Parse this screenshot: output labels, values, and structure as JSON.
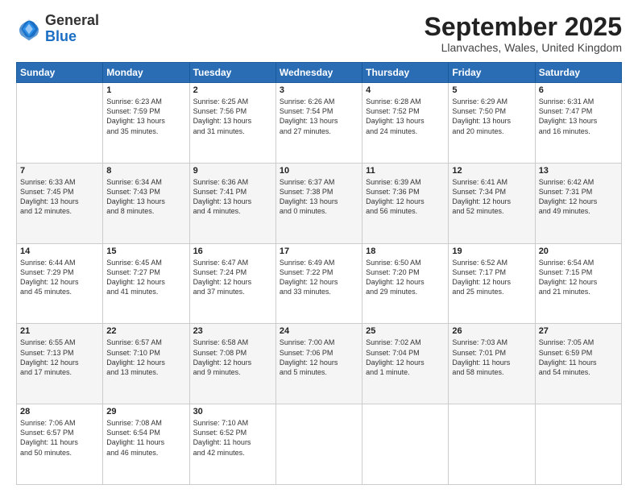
{
  "header": {
    "logo_general": "General",
    "logo_blue": "Blue",
    "month": "September 2025",
    "location": "Llanvaches, Wales, United Kingdom"
  },
  "days_of_week": [
    "Sunday",
    "Monday",
    "Tuesday",
    "Wednesday",
    "Thursday",
    "Friday",
    "Saturday"
  ],
  "weeks": [
    [
      {
        "day": "",
        "info": ""
      },
      {
        "day": "1",
        "info": "Sunrise: 6:23 AM\nSunset: 7:59 PM\nDaylight: 13 hours\nand 35 minutes."
      },
      {
        "day": "2",
        "info": "Sunrise: 6:25 AM\nSunset: 7:56 PM\nDaylight: 13 hours\nand 31 minutes."
      },
      {
        "day": "3",
        "info": "Sunrise: 6:26 AM\nSunset: 7:54 PM\nDaylight: 13 hours\nand 27 minutes."
      },
      {
        "day": "4",
        "info": "Sunrise: 6:28 AM\nSunset: 7:52 PM\nDaylight: 13 hours\nand 24 minutes."
      },
      {
        "day": "5",
        "info": "Sunrise: 6:29 AM\nSunset: 7:50 PM\nDaylight: 13 hours\nand 20 minutes."
      },
      {
        "day": "6",
        "info": "Sunrise: 6:31 AM\nSunset: 7:47 PM\nDaylight: 13 hours\nand 16 minutes."
      }
    ],
    [
      {
        "day": "7",
        "info": "Sunrise: 6:33 AM\nSunset: 7:45 PM\nDaylight: 13 hours\nand 12 minutes."
      },
      {
        "day": "8",
        "info": "Sunrise: 6:34 AM\nSunset: 7:43 PM\nDaylight: 13 hours\nand 8 minutes."
      },
      {
        "day": "9",
        "info": "Sunrise: 6:36 AM\nSunset: 7:41 PM\nDaylight: 13 hours\nand 4 minutes."
      },
      {
        "day": "10",
        "info": "Sunrise: 6:37 AM\nSunset: 7:38 PM\nDaylight: 13 hours\nand 0 minutes."
      },
      {
        "day": "11",
        "info": "Sunrise: 6:39 AM\nSunset: 7:36 PM\nDaylight: 12 hours\nand 56 minutes."
      },
      {
        "day": "12",
        "info": "Sunrise: 6:41 AM\nSunset: 7:34 PM\nDaylight: 12 hours\nand 52 minutes."
      },
      {
        "day": "13",
        "info": "Sunrise: 6:42 AM\nSunset: 7:31 PM\nDaylight: 12 hours\nand 49 minutes."
      }
    ],
    [
      {
        "day": "14",
        "info": "Sunrise: 6:44 AM\nSunset: 7:29 PM\nDaylight: 12 hours\nand 45 minutes."
      },
      {
        "day": "15",
        "info": "Sunrise: 6:45 AM\nSunset: 7:27 PM\nDaylight: 12 hours\nand 41 minutes."
      },
      {
        "day": "16",
        "info": "Sunrise: 6:47 AM\nSunset: 7:24 PM\nDaylight: 12 hours\nand 37 minutes."
      },
      {
        "day": "17",
        "info": "Sunrise: 6:49 AM\nSunset: 7:22 PM\nDaylight: 12 hours\nand 33 minutes."
      },
      {
        "day": "18",
        "info": "Sunrise: 6:50 AM\nSunset: 7:20 PM\nDaylight: 12 hours\nand 29 minutes."
      },
      {
        "day": "19",
        "info": "Sunrise: 6:52 AM\nSunset: 7:17 PM\nDaylight: 12 hours\nand 25 minutes."
      },
      {
        "day": "20",
        "info": "Sunrise: 6:54 AM\nSunset: 7:15 PM\nDaylight: 12 hours\nand 21 minutes."
      }
    ],
    [
      {
        "day": "21",
        "info": "Sunrise: 6:55 AM\nSunset: 7:13 PM\nDaylight: 12 hours\nand 17 minutes."
      },
      {
        "day": "22",
        "info": "Sunrise: 6:57 AM\nSunset: 7:10 PM\nDaylight: 12 hours\nand 13 minutes."
      },
      {
        "day": "23",
        "info": "Sunrise: 6:58 AM\nSunset: 7:08 PM\nDaylight: 12 hours\nand 9 minutes."
      },
      {
        "day": "24",
        "info": "Sunrise: 7:00 AM\nSunset: 7:06 PM\nDaylight: 12 hours\nand 5 minutes."
      },
      {
        "day": "25",
        "info": "Sunrise: 7:02 AM\nSunset: 7:04 PM\nDaylight: 12 hours\nand 1 minute."
      },
      {
        "day": "26",
        "info": "Sunrise: 7:03 AM\nSunset: 7:01 PM\nDaylight: 11 hours\nand 58 minutes."
      },
      {
        "day": "27",
        "info": "Sunrise: 7:05 AM\nSunset: 6:59 PM\nDaylight: 11 hours\nand 54 minutes."
      }
    ],
    [
      {
        "day": "28",
        "info": "Sunrise: 7:06 AM\nSunset: 6:57 PM\nDaylight: 11 hours\nand 50 minutes."
      },
      {
        "day": "29",
        "info": "Sunrise: 7:08 AM\nSunset: 6:54 PM\nDaylight: 11 hours\nand 46 minutes."
      },
      {
        "day": "30",
        "info": "Sunrise: 7:10 AM\nSunset: 6:52 PM\nDaylight: 11 hours\nand 42 minutes."
      },
      {
        "day": "",
        "info": ""
      },
      {
        "day": "",
        "info": ""
      },
      {
        "day": "",
        "info": ""
      },
      {
        "day": "",
        "info": ""
      }
    ]
  ]
}
